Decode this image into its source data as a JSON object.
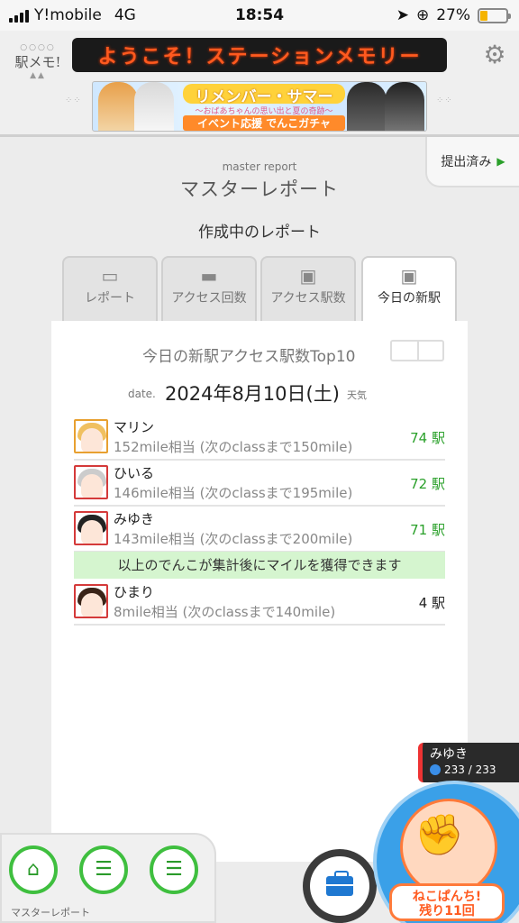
{
  "status": {
    "carrier": "Y!mobile",
    "network": "4G",
    "time": "18:54",
    "battery": "27%"
  },
  "header": {
    "logo_text": "駅メモ!",
    "marquee": "ようこそ！ステーションメモリー",
    "banner": {
      "title": "リメンバー・サマー",
      "subtitle": "〜おばあちゃんの思い出と夏の奇跡〜",
      "cta": "イベント応援 でんこガチャ"
    }
  },
  "submitted_label": "提出済み",
  "report": {
    "title_en": "master report",
    "title_jp": "マスターレポート",
    "in_progress": "作成中のレポート"
  },
  "tabs": [
    {
      "label": "レポート",
      "icon": "document-icon"
    },
    {
      "label": "アクセス回数",
      "icon": "card-icon"
    },
    {
      "label": "アクセス駅数",
      "icon": "train-icon"
    },
    {
      "label": "今日の新駅",
      "icon": "new-train-icon",
      "active": true
    }
  ],
  "panel": {
    "heading": "今日の新駅アクセス駅数Top10",
    "date_label": "date.",
    "date_value": "2024年8月10日(土)",
    "weather_label": "天気",
    "notice": "以上のでんこが集計後にマイルを獲得できます"
  },
  "ranking": [
    {
      "name": "マリン",
      "mile": "152mile相当 (次のclassまで150mile)",
      "stations": "74 駅"
    },
    {
      "name": "ひいる",
      "mile": "146mile相当 (次のclassまで195mile)",
      "stations": "72 駅"
    },
    {
      "name": "みゆき",
      "mile": "143mile相当 (次のclassまで200mile)",
      "stations": "71 駅"
    },
    {
      "name": "ひまり",
      "mile": "8mile相当 (次のclassまで140mile)",
      "stations": "4 駅"
    }
  ],
  "user_card": {
    "name": "みゆき",
    "hp": "233 / 233"
  },
  "punch": {
    "line1": "ねこぱんち!",
    "line2": "残り11回"
  },
  "bottom_nav": {
    "label": "マスターレポート"
  },
  "colors": {
    "accent_green": "#2aa02a",
    "marquee_orange": "#ff5a1f",
    "notice_bg": "#d5f5cf"
  }
}
